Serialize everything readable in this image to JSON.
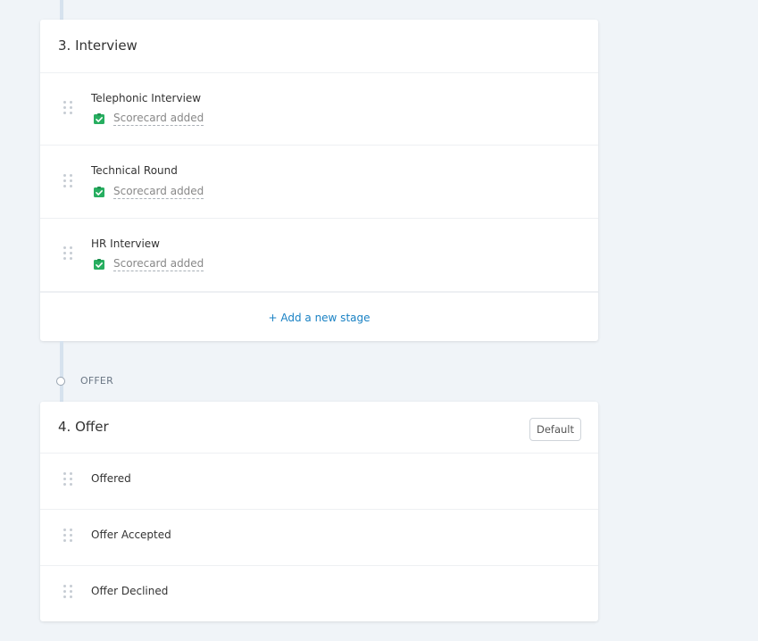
{
  "colors": {
    "background": "#f0f4f8",
    "card": "#ffffff",
    "accent_link": "#1a82c4",
    "scorecard_green": "#27ae60",
    "timeline": "#d6e2ee"
  },
  "interview_card": {
    "title": "3. Interview",
    "stages": [
      {
        "name": "Telephonic Interview",
        "scorecard": "Scorecard added",
        "icon": "checklist-icon"
      },
      {
        "name": "Technical Round",
        "scorecard": "Scorecard added",
        "icon": "checklist-icon"
      },
      {
        "name": "HR Interview",
        "scorecard": "Scorecard added",
        "icon": "checklist-icon"
      }
    ],
    "add_stage_label": "+ Add a new stage"
  },
  "offer_section": {
    "label": "OFFER"
  },
  "offer_card": {
    "title": "4. Offer",
    "default_label": "Default",
    "stages": [
      {
        "name": "Offered"
      },
      {
        "name": "Offer Accepted"
      },
      {
        "name": "Offer Declined"
      }
    ]
  }
}
